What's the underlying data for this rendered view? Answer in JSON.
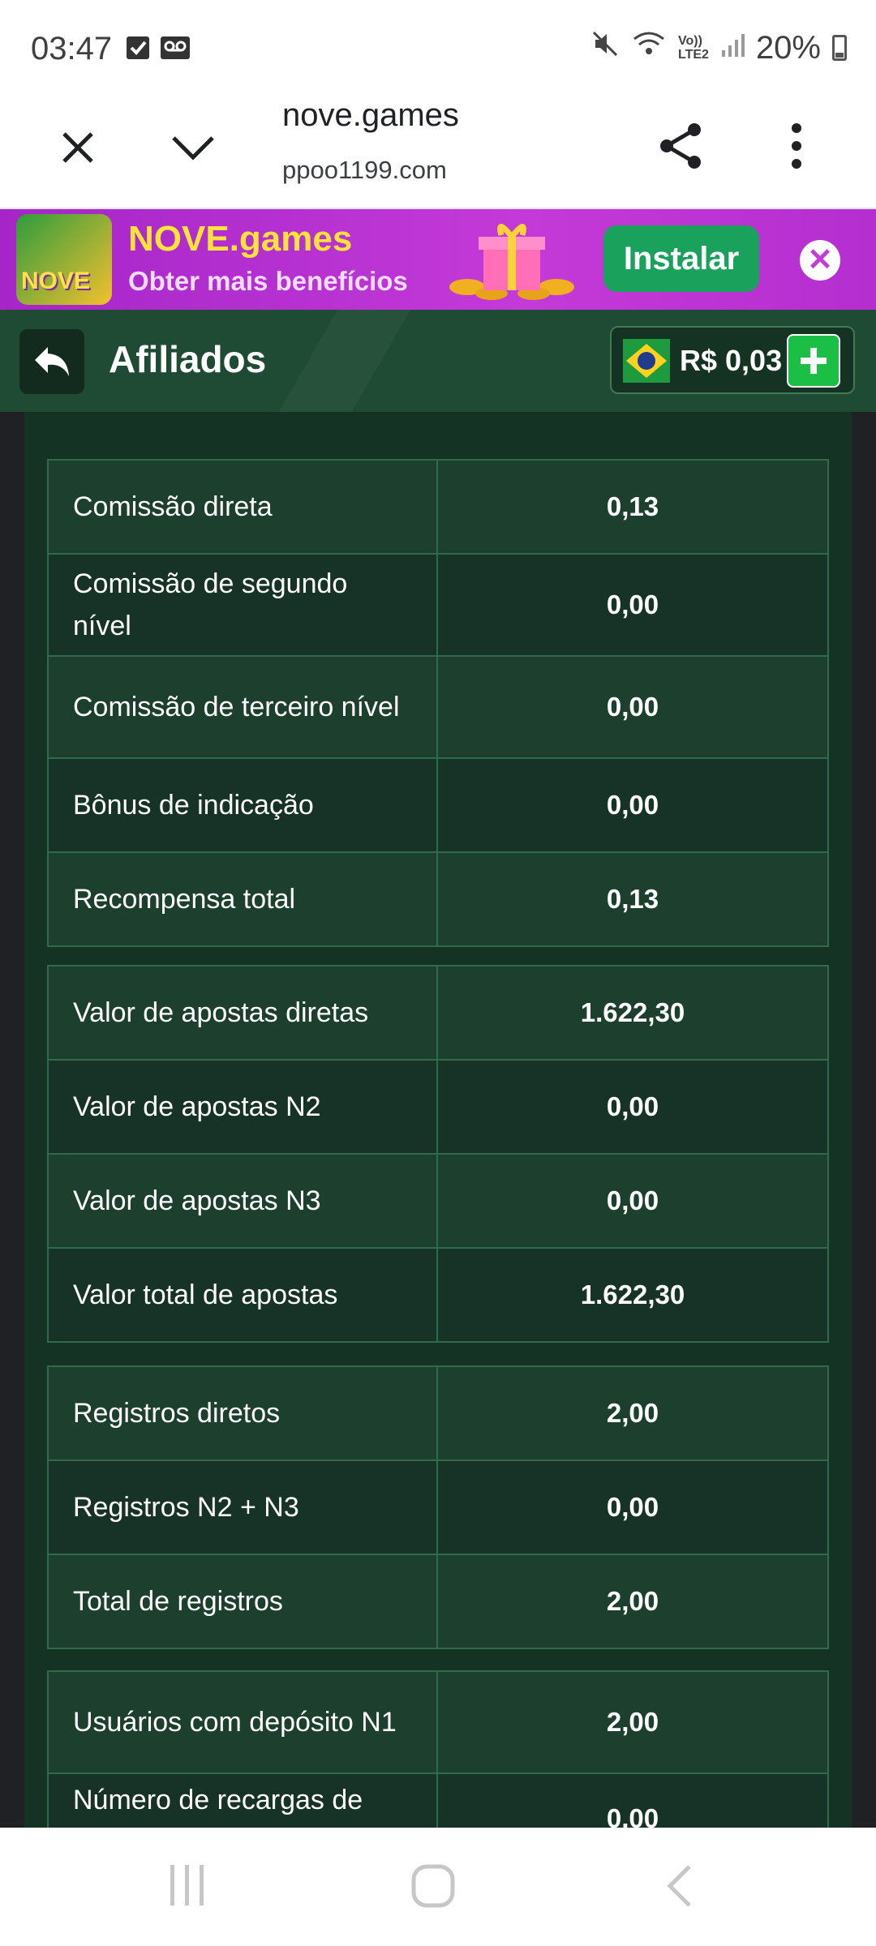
{
  "status_bar": {
    "time": "03:47",
    "battery": "20%",
    "icons": [
      "check-box-icon",
      "voicemail-icon",
      "mute-icon",
      "wifi-icon",
      "volte-icon",
      "signal-icon",
      "battery-icon"
    ],
    "volte_label": "Vo))\nLTE2"
  },
  "browser": {
    "title": "nove.games",
    "url": "ppoo1199.com",
    "icons": [
      "close-icon",
      "chevron-down-icon",
      "share-icon",
      "more-vert-icon"
    ]
  },
  "banner": {
    "logo_text": "NOVE",
    "title": "NOVE.games",
    "subtitle": "Obter mais benefícios",
    "install_label": "Instalar",
    "close_symbol": "✕"
  },
  "header": {
    "title": "Afiliados",
    "balance": "R$ 0,03"
  },
  "tables": [
    {
      "rows": [
        {
          "label": "Comissão direta",
          "value": "0,13"
        },
        {
          "label": "Comissão de segundo nível",
          "value": "0,00"
        },
        {
          "label": "Comissão de terceiro nível",
          "value": "0,00"
        },
        {
          "label": "Bônus de indicação",
          "value": "0,00"
        },
        {
          "label": "Recompensa total",
          "value": "0,13"
        }
      ]
    },
    {
      "rows": [
        {
          "label": "Valor de apostas diretas",
          "value": "1.622,30"
        },
        {
          "label": "Valor de apostas N2",
          "value": "0,00"
        },
        {
          "label": "Valor de apostas N3",
          "value": "0,00"
        },
        {
          "label": "Valor total de apostas",
          "value": "1.622,30"
        }
      ]
    },
    {
      "rows": [
        {
          "label": "Registros diretos",
          "value": "2,00"
        },
        {
          "label": "Registros N2 + N3",
          "value": "0,00"
        },
        {
          "label": "Total de registros",
          "value": "2,00"
        }
      ]
    },
    {
      "rows": [
        {
          "label": "Usuários com depósito N1",
          "value": "2,00"
        },
        {
          "label": "Número de recargas de",
          "value": "0,00"
        }
      ]
    }
  ],
  "colors": {
    "header_bg": "#1f4a34",
    "panel_bg": "#153325",
    "row_light": "#1c3f2e",
    "row_dark": "#173226",
    "border": "#2f6a4b",
    "banner_bg": "#c43ad8",
    "install_bg": "#1aa15c"
  }
}
